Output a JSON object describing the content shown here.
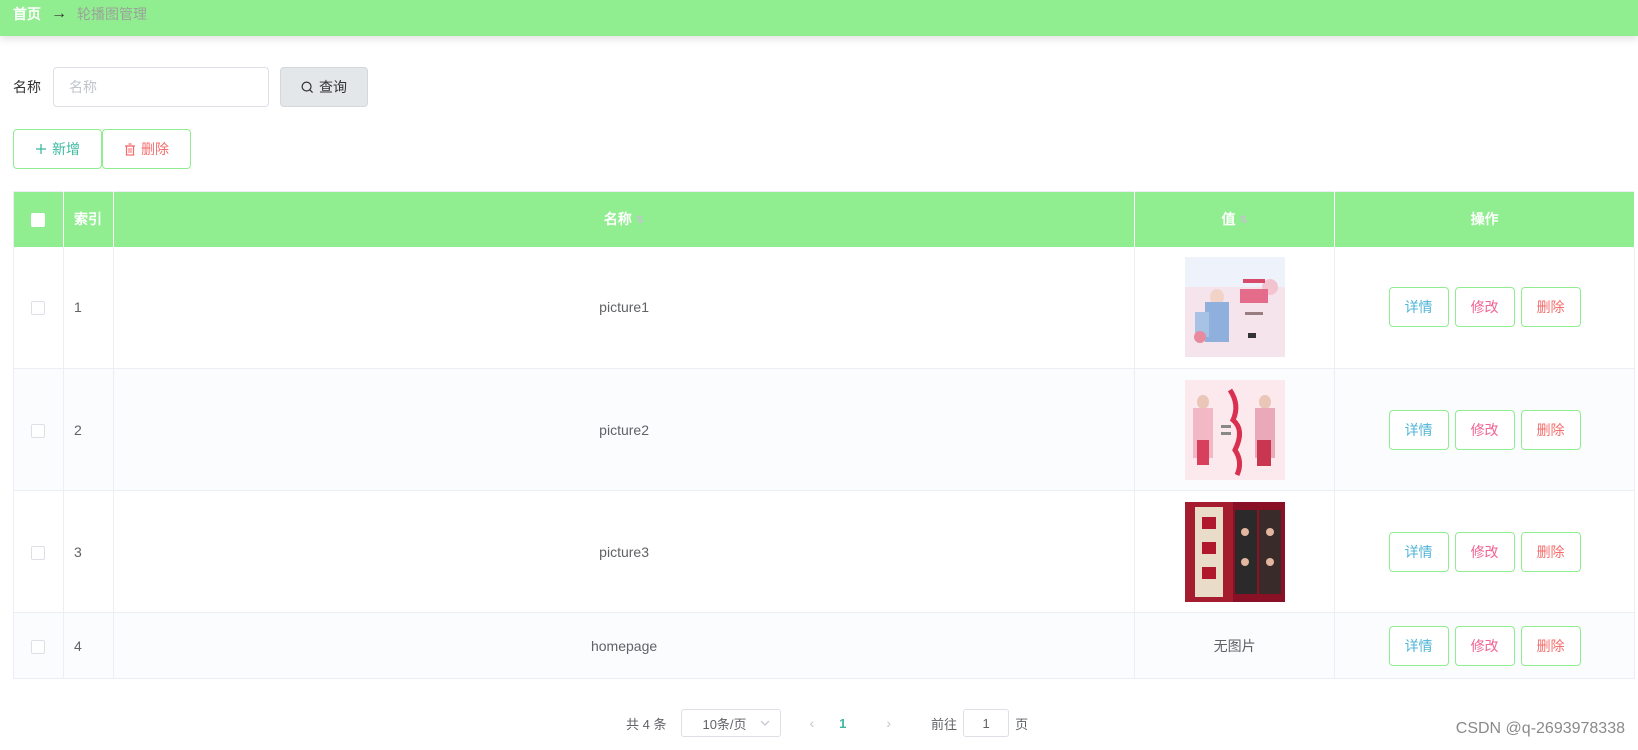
{
  "breadcrumb": {
    "home": "首页",
    "separator": "→",
    "current": "轮播图管理"
  },
  "search": {
    "label": "名称",
    "placeholder": "名称",
    "value": "",
    "button": "查询"
  },
  "actions": {
    "add": "新增",
    "delete": "删除"
  },
  "table": {
    "headers": {
      "index": "索引",
      "name": "名称",
      "value": "值",
      "ops": "操作"
    },
    "rows": [
      {
        "index": "1",
        "name": "picture1",
        "value": "",
        "image": "pink-banner"
      },
      {
        "index": "2",
        "name": "picture2",
        "value": "",
        "image": "pink-couple-banner"
      },
      {
        "index": "3",
        "name": "picture3",
        "value": "",
        "image": "red-poster"
      },
      {
        "index": "4",
        "name": "homepage",
        "value": "无图片",
        "image": ""
      }
    ],
    "row_buttons": {
      "detail": "详情",
      "edit": "修改",
      "delete": "删除"
    }
  },
  "pagination": {
    "total": "共 4 条",
    "page_size": "10条/页",
    "current_page": "1",
    "goto_prefix": "前往",
    "goto_value": "1",
    "goto_suffix": "页"
  },
  "watermark": "CSDN @q-2693978338",
  "colors": {
    "header": "#90ee90",
    "accent": "#3eb8a0",
    "danger": "#f56c6c"
  }
}
